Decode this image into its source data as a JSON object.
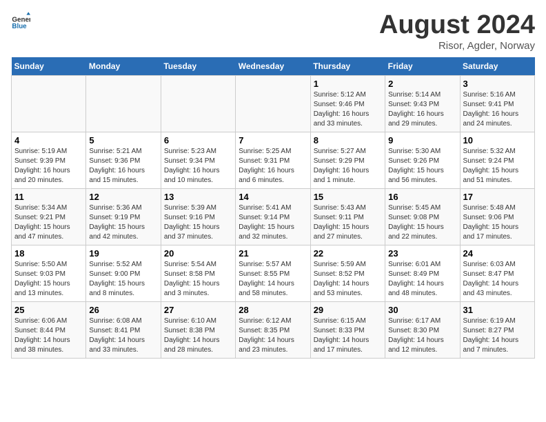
{
  "header": {
    "logo_general": "General",
    "logo_blue": "Blue",
    "main_title": "August 2024",
    "subtitle": "Risor, Agder, Norway"
  },
  "calendar": {
    "days_of_week": [
      "Sunday",
      "Monday",
      "Tuesday",
      "Wednesday",
      "Thursday",
      "Friday",
      "Saturday"
    ],
    "weeks": [
      [
        {
          "day": "",
          "info": ""
        },
        {
          "day": "",
          "info": ""
        },
        {
          "day": "",
          "info": ""
        },
        {
          "day": "",
          "info": ""
        },
        {
          "day": "1",
          "info": "Sunrise: 5:12 AM\nSunset: 9:46 PM\nDaylight: 16 hours\nand 33 minutes."
        },
        {
          "day": "2",
          "info": "Sunrise: 5:14 AM\nSunset: 9:43 PM\nDaylight: 16 hours\nand 29 minutes."
        },
        {
          "day": "3",
          "info": "Sunrise: 5:16 AM\nSunset: 9:41 PM\nDaylight: 16 hours\nand 24 minutes."
        }
      ],
      [
        {
          "day": "4",
          "info": "Sunrise: 5:19 AM\nSunset: 9:39 PM\nDaylight: 16 hours\nand 20 minutes."
        },
        {
          "day": "5",
          "info": "Sunrise: 5:21 AM\nSunset: 9:36 PM\nDaylight: 16 hours\nand 15 minutes."
        },
        {
          "day": "6",
          "info": "Sunrise: 5:23 AM\nSunset: 9:34 PM\nDaylight: 16 hours\nand 10 minutes."
        },
        {
          "day": "7",
          "info": "Sunrise: 5:25 AM\nSunset: 9:31 PM\nDaylight: 16 hours\nand 6 minutes."
        },
        {
          "day": "8",
          "info": "Sunrise: 5:27 AM\nSunset: 9:29 PM\nDaylight: 16 hours\nand 1 minute."
        },
        {
          "day": "9",
          "info": "Sunrise: 5:30 AM\nSunset: 9:26 PM\nDaylight: 15 hours\nand 56 minutes."
        },
        {
          "day": "10",
          "info": "Sunrise: 5:32 AM\nSunset: 9:24 PM\nDaylight: 15 hours\nand 51 minutes."
        }
      ],
      [
        {
          "day": "11",
          "info": "Sunrise: 5:34 AM\nSunset: 9:21 PM\nDaylight: 15 hours\nand 47 minutes."
        },
        {
          "day": "12",
          "info": "Sunrise: 5:36 AM\nSunset: 9:19 PM\nDaylight: 15 hours\nand 42 minutes."
        },
        {
          "day": "13",
          "info": "Sunrise: 5:39 AM\nSunset: 9:16 PM\nDaylight: 15 hours\nand 37 minutes."
        },
        {
          "day": "14",
          "info": "Sunrise: 5:41 AM\nSunset: 9:14 PM\nDaylight: 15 hours\nand 32 minutes."
        },
        {
          "day": "15",
          "info": "Sunrise: 5:43 AM\nSunset: 9:11 PM\nDaylight: 15 hours\nand 27 minutes."
        },
        {
          "day": "16",
          "info": "Sunrise: 5:45 AM\nSunset: 9:08 PM\nDaylight: 15 hours\nand 22 minutes."
        },
        {
          "day": "17",
          "info": "Sunrise: 5:48 AM\nSunset: 9:06 PM\nDaylight: 15 hours\nand 17 minutes."
        }
      ],
      [
        {
          "day": "18",
          "info": "Sunrise: 5:50 AM\nSunset: 9:03 PM\nDaylight: 15 hours\nand 13 minutes."
        },
        {
          "day": "19",
          "info": "Sunrise: 5:52 AM\nSunset: 9:00 PM\nDaylight: 15 hours\nand 8 minutes."
        },
        {
          "day": "20",
          "info": "Sunrise: 5:54 AM\nSunset: 8:58 PM\nDaylight: 15 hours\nand 3 minutes."
        },
        {
          "day": "21",
          "info": "Sunrise: 5:57 AM\nSunset: 8:55 PM\nDaylight: 14 hours\nand 58 minutes."
        },
        {
          "day": "22",
          "info": "Sunrise: 5:59 AM\nSunset: 8:52 PM\nDaylight: 14 hours\nand 53 minutes."
        },
        {
          "day": "23",
          "info": "Sunrise: 6:01 AM\nSunset: 8:49 PM\nDaylight: 14 hours\nand 48 minutes."
        },
        {
          "day": "24",
          "info": "Sunrise: 6:03 AM\nSunset: 8:47 PM\nDaylight: 14 hours\nand 43 minutes."
        }
      ],
      [
        {
          "day": "25",
          "info": "Sunrise: 6:06 AM\nSunset: 8:44 PM\nDaylight: 14 hours\nand 38 minutes."
        },
        {
          "day": "26",
          "info": "Sunrise: 6:08 AM\nSunset: 8:41 PM\nDaylight: 14 hours\nand 33 minutes."
        },
        {
          "day": "27",
          "info": "Sunrise: 6:10 AM\nSunset: 8:38 PM\nDaylight: 14 hours\nand 28 minutes."
        },
        {
          "day": "28",
          "info": "Sunrise: 6:12 AM\nSunset: 8:35 PM\nDaylight: 14 hours\nand 23 minutes."
        },
        {
          "day": "29",
          "info": "Sunrise: 6:15 AM\nSunset: 8:33 PM\nDaylight: 14 hours\nand 17 minutes."
        },
        {
          "day": "30",
          "info": "Sunrise: 6:17 AM\nSunset: 8:30 PM\nDaylight: 14 hours\nand 12 minutes."
        },
        {
          "day": "31",
          "info": "Sunrise: 6:19 AM\nSunset: 8:27 PM\nDaylight: 14 hours\nand 7 minutes."
        }
      ]
    ]
  }
}
